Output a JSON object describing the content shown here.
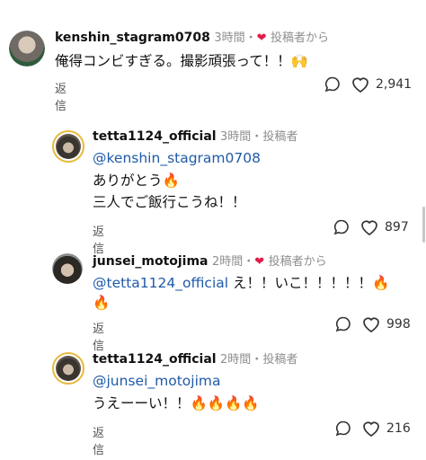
{
  "comments": [
    {
      "username": "kenshin_stagram0708",
      "time": "3時間",
      "sep": "・",
      "author_tag": "投稿者から",
      "liked_by_author": true,
      "line1": "俺得コンビすぎる。撮影頑張って！！🙌",
      "reply_label": "返信",
      "like_count": "2,941"
    },
    {
      "username": "tetta1124_official",
      "time": "3時間",
      "sep": "・",
      "author_tag": "投稿者",
      "liked_by_author": false,
      "mention": "@kenshin_stagram0708",
      "line2": "ありがとう🔥",
      "line3": "三人でご飯行こうね！！",
      "reply_label": "返信",
      "like_count": "897"
    },
    {
      "username": "junsei_motojima",
      "time": "2時間",
      "sep": "・",
      "author_tag": "投稿者から",
      "liked_by_author": true,
      "mention": "@tetta1124_official",
      "line1_rest": " え！！いこ！！！！！🔥",
      "line2": "🔥",
      "reply_label": "返信",
      "like_count": "998"
    },
    {
      "username": "tetta1124_official",
      "time": "2時間",
      "sep": "・",
      "author_tag": "投稿者",
      "liked_by_author": false,
      "mention": "@junsei_motojima",
      "line2": "うえーーい！！🔥🔥🔥🔥",
      "reply_label": "返信",
      "like_count": "216"
    }
  ],
  "icons": {
    "reply_bubble": "speech-bubble-icon",
    "like": "heart-outline-icon",
    "author_heart": "heart-filled-icon"
  },
  "colors": {
    "mention": "#1f5aa8",
    "heart": "#e11d48",
    "story_ring": "#e8b93a"
  }
}
